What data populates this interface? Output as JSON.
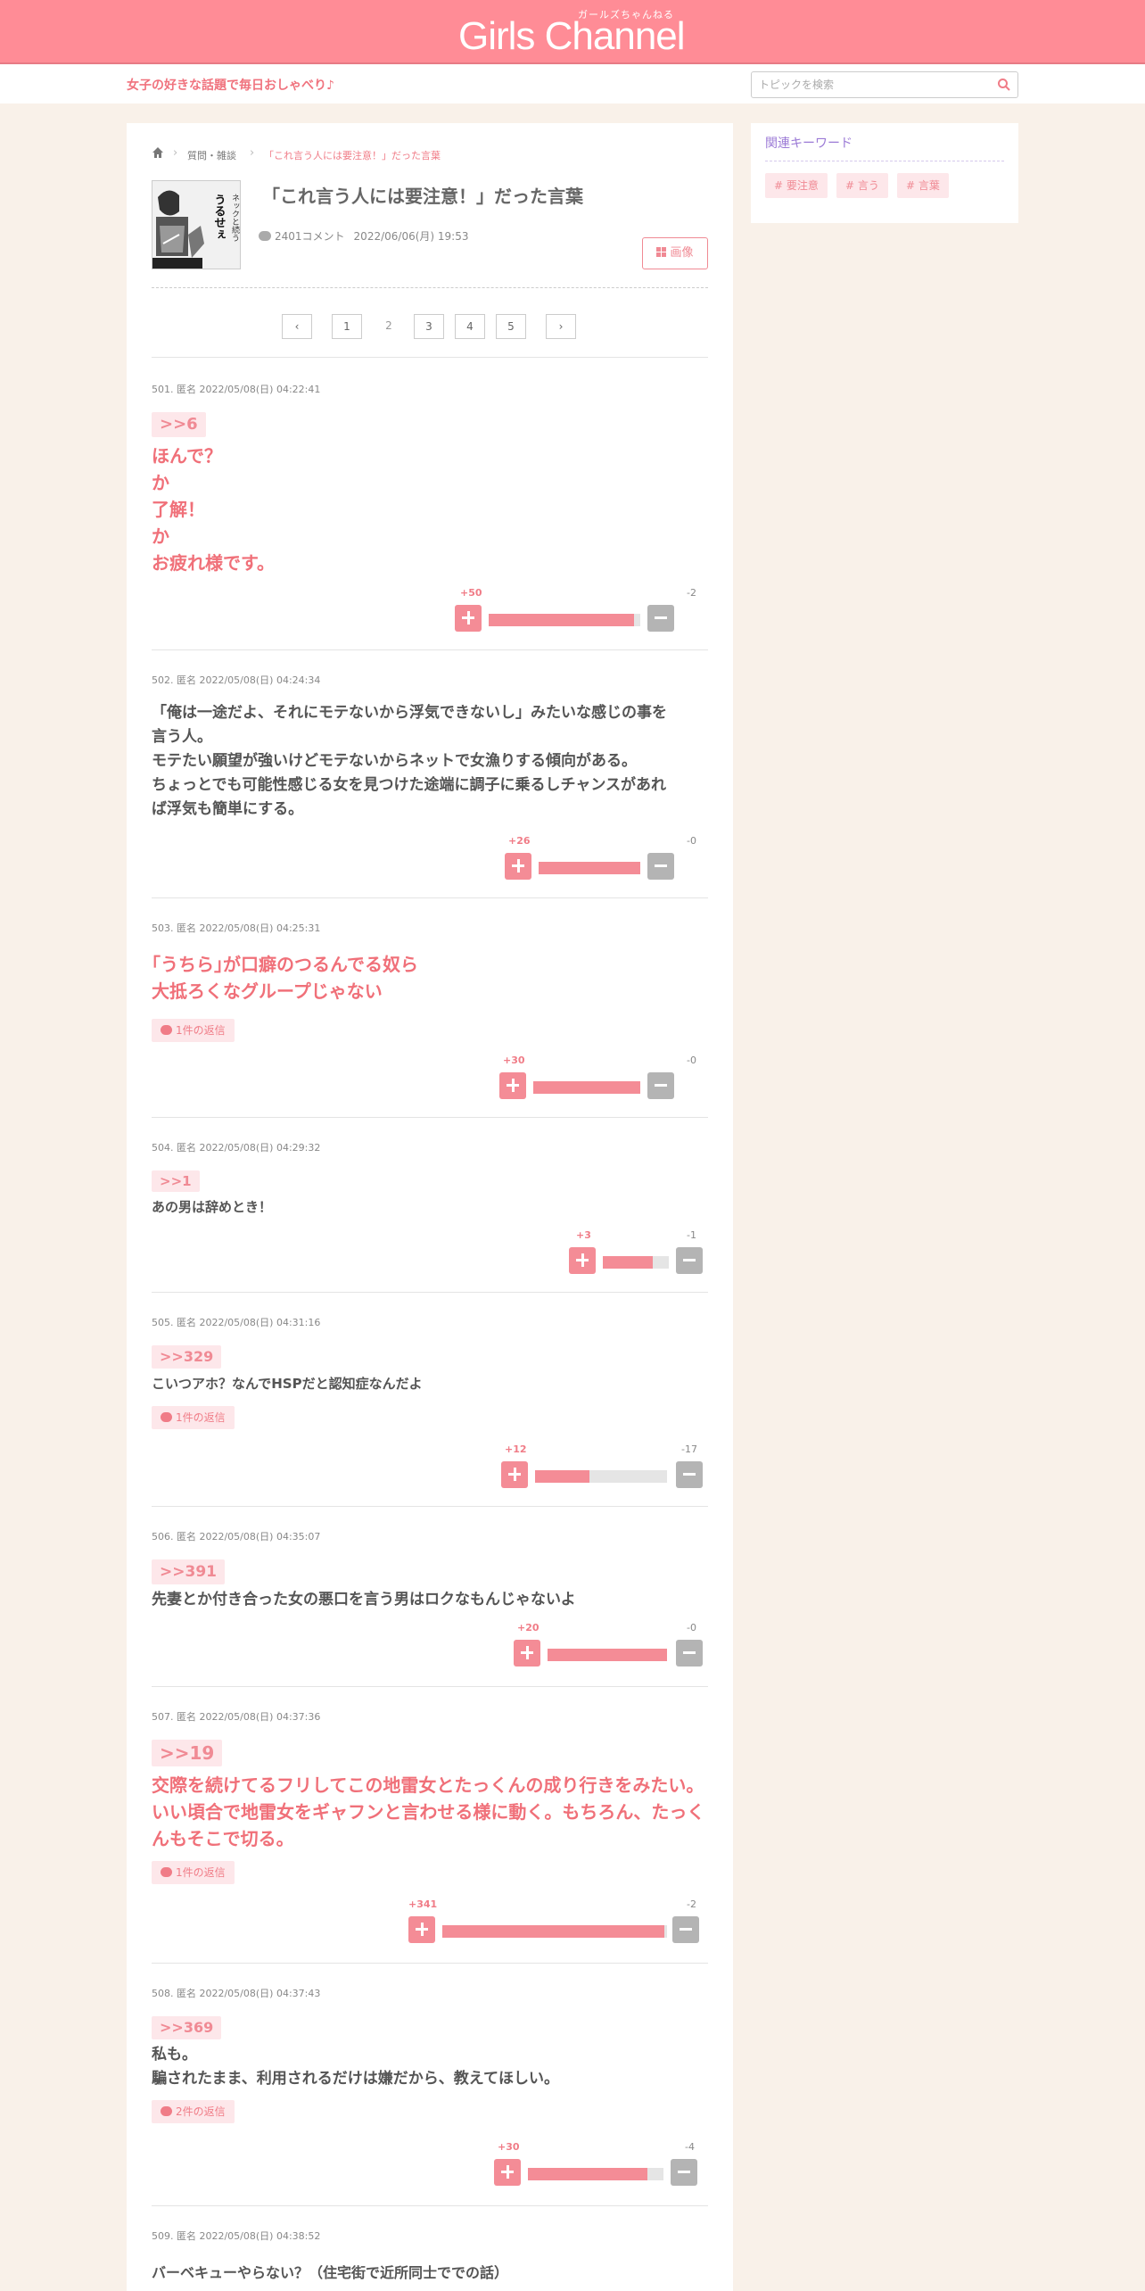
{
  "header": {
    "logo": "Girls Channel",
    "logo_sub": "ガールズちゃんねる"
  },
  "subbar": {
    "tagline": "女子の好きな話題で毎日おしゃべり♪",
    "search_placeholder": "トピックを検索"
  },
  "breadcrumb": {
    "category": "質問・雑談",
    "current": "「これ言う人には要注意！」だった言葉"
  },
  "topic": {
    "title": "「これ言う人には要注意！」だった言葉",
    "comment_count": "2401コメント",
    "date": "2022/06/06(月) 19:53",
    "image_button": "画像",
    "thumb_text": [
      "うるせぇ",
      "ネックと続う"
    ]
  },
  "pagination": {
    "prev": "‹",
    "pages": [
      "1",
      "2",
      "3",
      "4",
      "5"
    ],
    "current": "2",
    "next": "›"
  },
  "sidebar": {
    "title": "関連キーワード",
    "keywords": [
      "# 要注意",
      "# 言う",
      "# 言葉"
    ]
  },
  "posts": [
    {
      "meta": "501. 匿名 2022/05/08(日) 04:22:41",
      "anchor": ">>6",
      "lines": [
        "ほんで？",
        "か",
        "了解！",
        "か",
        "お疲れ様です。"
      ],
      "plus": "+50",
      "minus": "-2",
      "ratio": 0.96
    },
    {
      "meta": "502. 匿名 2022/05/08(日) 04:24:34",
      "lines": [
        "「俺は一途だよ、それにモテないから浮気できないし」みたいな感じの事を",
        "言う人。",
        "モテたい願望が強いけどモテないからネットで女漁りする傾向がある。",
        "ちょっとでも可能性感じる女を見つけた途端に調子に乗るしチャンスがあれ",
        "ば浮気も簡単にする。"
      ],
      "plus": "+26",
      "minus": "-0",
      "ratio": 1.0
    },
    {
      "meta": "503. 匿名 2022/05/08(日) 04:25:31",
      "lines": [
        "｢うちら｣が口癖のつるんでる奴ら",
        "大抵ろくなグループじゃない"
      ],
      "reply": "1件の返信",
      "plus": "+30",
      "minus": "-0",
      "ratio": 1.0
    },
    {
      "meta": "504. 匿名 2022/05/08(日) 04:29:32",
      "anchor": ">>1",
      "lines": [
        "あの男は辞めとき！"
      ],
      "plus": "+3",
      "minus": "-1",
      "ratio": 0.75
    },
    {
      "meta": "505. 匿名 2022/05/08(日) 04:31:16",
      "anchor": ">>329",
      "lines": [
        "こいつアホ？なんでHSPだと認知症なんだよ"
      ],
      "reply": "1件の返信",
      "plus": "+12",
      "minus": "-17",
      "ratio": 0.41
    },
    {
      "meta": "506. 匿名 2022/05/08(日) 04:35:07",
      "anchor": ">>391",
      "lines": [
        "先妻とか付き合った女の悪口を言う男はロクなもんじゃないよ"
      ],
      "plus": "+20",
      "minus": "-0",
      "ratio": 1.0
    },
    {
      "meta": "507. 匿名 2022/05/08(日) 04:37:36",
      "anchor": ">>19",
      "lines": [
        "交際を続けてるフリしてこの地雷女とたっくんの成り行きをみたい。",
        "いい頃合で地雷女をギャフンと言わせる様に動く。もちろん、たっく",
        "んもそこで切る。"
      ],
      "reply": "1件の返信",
      "plus": "+341",
      "minus": "-2",
      "ratio": 0.99
    },
    {
      "meta": "508. 匿名 2022/05/08(日) 04:37:43",
      "anchor": ">>369",
      "lines": [
        "私も。",
        "騙されたまま、利用されるだけは嫌だから、教えてほしい。"
      ],
      "reply": "2件の返信",
      "plus": "+30",
      "minus": "-4",
      "ratio": 0.88
    },
    {
      "meta": "509. 匿名 2022/05/08(日) 04:38:52",
      "lines": [
        "バーベキューやらない？（住宅街で近所同士ででの話）"
      ]
    }
  ]
}
